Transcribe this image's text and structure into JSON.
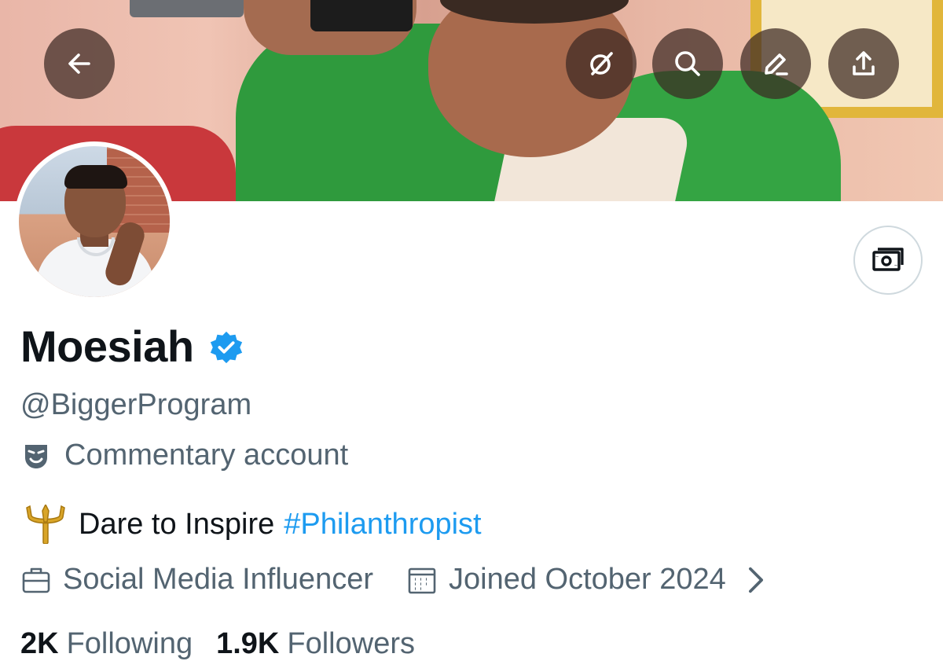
{
  "profile": {
    "display_name": "Moesiah",
    "handle": "@BiggerProgram",
    "label": "Commentary account",
    "bio_text": "Dare to Inspire",
    "bio_hashtag": "#Philanthropist",
    "profession": "Social Media Influencer",
    "joined": "Joined October 2024",
    "following_count": "2K",
    "following_label": "Following",
    "followers_count": "1.9K",
    "followers_label": "Followers"
  },
  "icons": {
    "back": "arrow-left-icon",
    "grok": "grok-icon",
    "search": "search-icon",
    "edit": "pencil-icon",
    "share": "share-icon",
    "tip": "money-icon",
    "verified": "verified-badge-icon",
    "label": "theater-mask-icon",
    "bio_emoji": "trident-emoji",
    "profession": "briefcase-icon",
    "joined": "calendar-icon",
    "chevron": "chevron-right-icon"
  },
  "colors": {
    "accent": "#1d9bf0",
    "text_primary": "#0f1419",
    "text_secondary": "#536471"
  }
}
